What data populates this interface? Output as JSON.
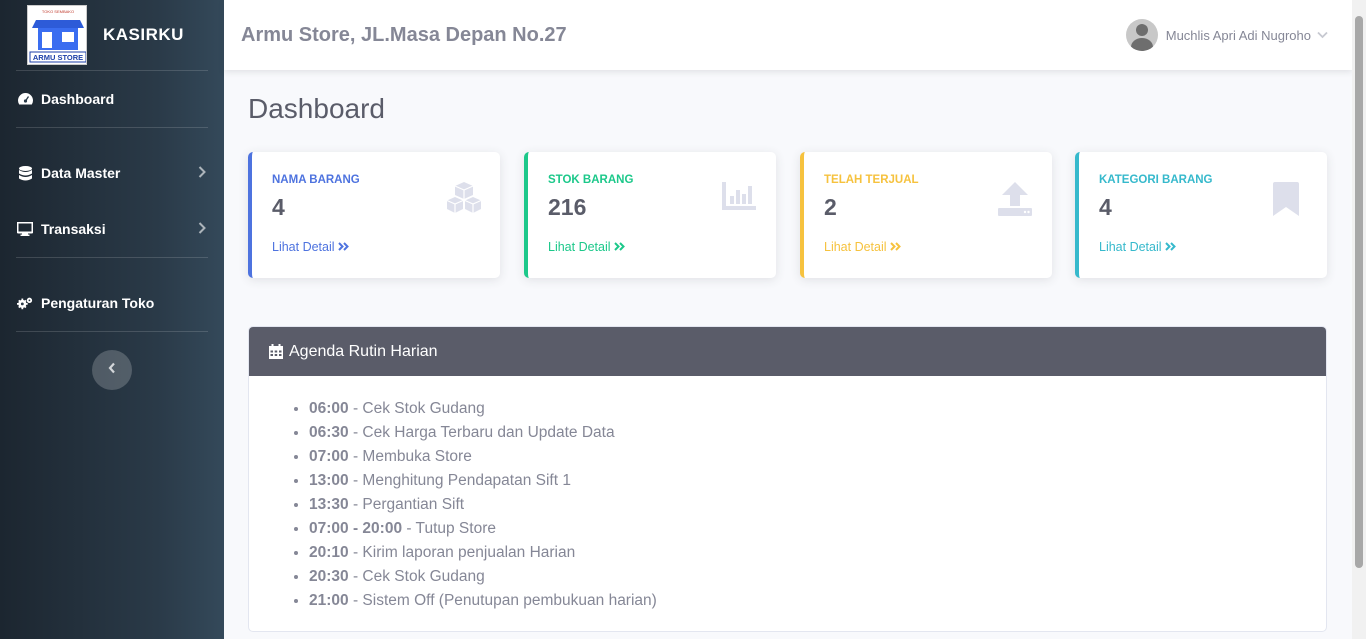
{
  "brand": {
    "logo_text_top": "TOKO SEMBAKO",
    "logo_text": "ARMU STORE",
    "name": "KASIRKU"
  },
  "sidebar": {
    "items": [
      {
        "label": "Dashboard",
        "icon": "tachometer-icon"
      },
      {
        "label": "Data Master",
        "icon": "database-icon"
      },
      {
        "label": "Transaksi",
        "icon": "desktop-icon"
      },
      {
        "label": "Pengaturan Toko",
        "icon": "cogs-icon"
      }
    ]
  },
  "topbar": {
    "store_title": "Armu Store, JL.Masa Depan No.27",
    "user_name": "Muchlis Apri Adi Nugroho"
  },
  "page": {
    "title": "Dashboard"
  },
  "cards": [
    {
      "label": "NAMA BARANG",
      "value": "4",
      "link": "Lihat Detail",
      "color": "#4e73df",
      "icon": "cubes-icon"
    },
    {
      "label": "STOK BARANG",
      "value": "216",
      "link": "Lihat Detail",
      "color": "#1cc88a",
      "icon": "chart-bar-icon"
    },
    {
      "label": "TELAH TERJUAL",
      "value": "2",
      "link": "Lihat Detail",
      "color": "#f6c23e",
      "icon": "upload-icon"
    },
    {
      "label": "KATEGORI BARANG",
      "value": "4",
      "link": "Lihat Detail",
      "color": "#36b9cc",
      "icon": "bookmark-icon"
    }
  ],
  "agenda": {
    "title": "Agenda Rutin Harian",
    "items": [
      {
        "time": "06:00",
        "text": " - Cek Stok Gudang"
      },
      {
        "time": "06:30",
        "text": " - Cek Harga Terbaru dan Update Data"
      },
      {
        "time": "07:00",
        "text": " - Membuka Store"
      },
      {
        "time": "13:00",
        "text": " - Menghitung Pendapatan Sift 1"
      },
      {
        "time": "13:30",
        "text": " - Pergantian Sift"
      },
      {
        "time": "07:00 - 20:00",
        "text": " - Tutup Store"
      },
      {
        "time": "20:10",
        "text": " - Kirim laporan penjualan Harian"
      },
      {
        "time": "20:30",
        "text": " - Cek Stok Gudang"
      },
      {
        "time": "21:00",
        "text": " - Sistem Off (Penutupan pembukuan harian)"
      }
    ]
  }
}
